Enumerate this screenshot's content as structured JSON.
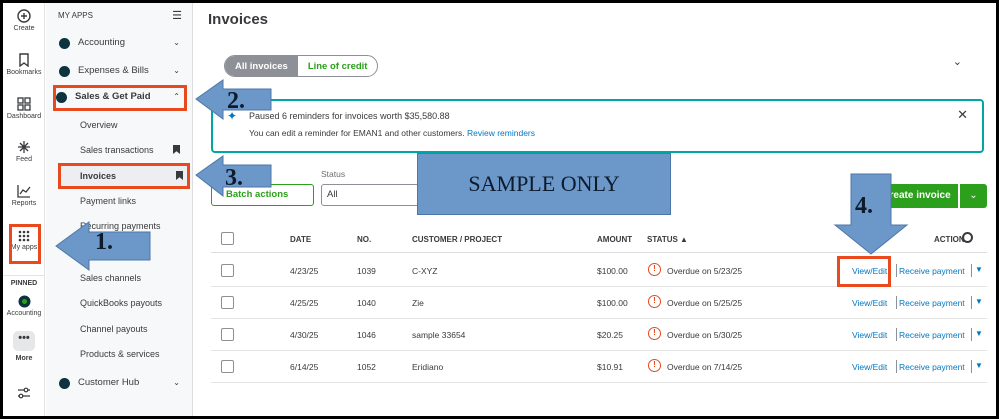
{
  "rail": {
    "items": [
      {
        "label": "Create",
        "icon": "plus-circle-icon"
      },
      {
        "label": "Bookmarks",
        "icon": "bookmark-icon"
      },
      {
        "label": "Dashboard",
        "icon": "grid-icon"
      },
      {
        "label": "Feed",
        "icon": "sparkle-icon"
      },
      {
        "label": "Reports",
        "icon": "chart-icon"
      },
      {
        "label": "My apps",
        "icon": "apps-icon"
      }
    ],
    "pinned_label": "PINNED",
    "pinned_app": "Accounting",
    "more_label": "More",
    "more_glyph": "•••"
  },
  "menu": {
    "heading": "MY APPS",
    "collapse_glyph": "☰",
    "apps": [
      {
        "label": "Accounting",
        "color": "#0d333f",
        "chevron": "⌄"
      },
      {
        "label": "Expenses & Bills",
        "color": "#0d333f",
        "chevron": "⌄"
      },
      {
        "label": "Sales & Get Paid",
        "color": "#0d333f",
        "chevron": "⌃"
      }
    ],
    "sub": [
      "Overview",
      "Sales transactions",
      "Invoices",
      "Payment links",
      "Recurring payments",
      "Sales channels",
      "QuickBooks payouts",
      "Channel payouts",
      "Products & services"
    ],
    "customer_hub": "Customer Hub",
    "customer_hub_chevron": "⌄"
  },
  "main": {
    "title": "Invoices",
    "tabs": [
      "All invoices",
      "Line of credit"
    ],
    "collapse_chevron": "⌄",
    "banner": {
      "line1": "Paused 6 reminders for invoices worth $35,580.88",
      "line2_prefix": "You can edit a reminder for EMAN1 and other customers.",
      "line2_link": "Review reminders",
      "close": "✕"
    },
    "batch_actions": "Batch actions",
    "status_label": "Status",
    "status_value": "All",
    "create_invoice": "Create invoice",
    "create_dropdown": "⌄"
  },
  "watermark": "SAMPLE ONLY",
  "table": {
    "headers": {
      "date": "DATE",
      "no": "NO.",
      "customer": "CUSTOMER / PROJECT",
      "amount": "AMOUNT",
      "status": "STATUS ▲",
      "action": "ACTION"
    },
    "rows": [
      {
        "date": "4/23/25",
        "no": "1039",
        "customer": "C-XYZ",
        "amount": "$100.00",
        "status": "Overdue on 5/23/25"
      },
      {
        "date": "4/25/25",
        "no": "1040",
        "customer": "Zie",
        "amount": "$100.00",
        "status": "Overdue on 5/25/25"
      },
      {
        "date": "4/30/25",
        "no": "1046",
        "customer": "sample 33654",
        "amount": "$20.25",
        "status": "Overdue on 5/30/25"
      },
      {
        "date": "6/14/25",
        "no": "1052",
        "customer": "Eridiano",
        "amount": "$10.91",
        "status": "Overdue on 7/14/25"
      }
    ],
    "view_edit": "View/Edit",
    "receive_payment": "Receive payment",
    "warn_glyph": "!",
    "dropdown_glyph": "▼"
  },
  "annotations": [
    "1.",
    "2.",
    "3.",
    "4."
  ],
  "colors": {
    "accent_green": "#2ca01c",
    "highlight": "#e8491d",
    "link": "#0077c5",
    "arrow": "#6b97c9"
  }
}
